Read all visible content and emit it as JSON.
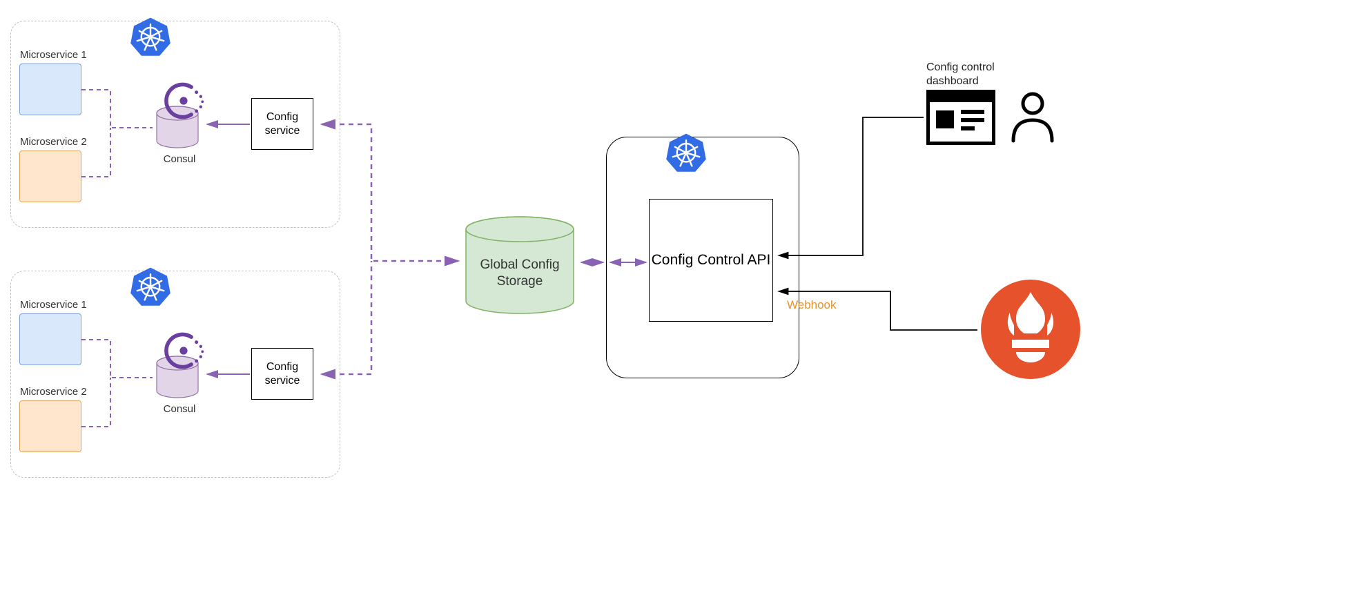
{
  "cluster1": {
    "ms1_label": "Microservice 1",
    "ms2_label": "Microservice 2",
    "consul_label": "Consul",
    "config_svc_label": "Config service"
  },
  "cluster2": {
    "ms1_label": "Microservice 1",
    "ms2_label": "Microservice 2",
    "consul_label": "Consul",
    "config_svc_label": "Config service"
  },
  "storage": {
    "label": "Global Config Storage"
  },
  "central": {
    "api_label": "Config Control API",
    "webhook_label": "Webhook"
  },
  "dashboard": {
    "title": "Config control dashboard"
  },
  "colors": {
    "purple_stroke": "#8a62b3",
    "purple_fill": "#e1d5e7",
    "green_stroke": "#82b366",
    "green_fill": "#d5e8d4",
    "orange": "#e8932a",
    "k8s_blue": "#326ce5",
    "prometheus": "#e6522c"
  }
}
